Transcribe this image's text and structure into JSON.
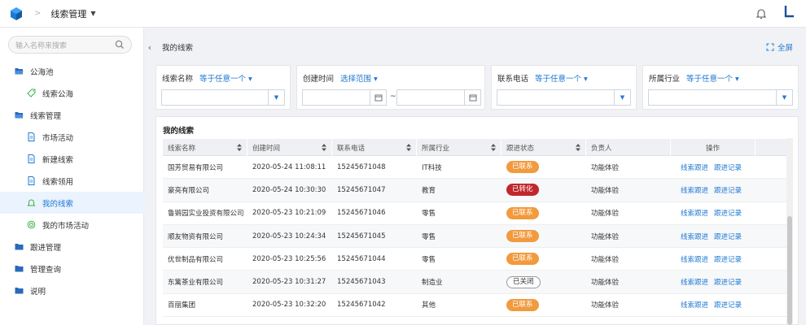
{
  "topbar": {
    "title": "线索管理"
  },
  "search": {
    "placeholder": "输入名称来搜索"
  },
  "menu": [
    {
      "label": "公海池",
      "level": 1,
      "icon": "folder-open-icon"
    },
    {
      "label": "线索公海",
      "level": 2,
      "icon": "tag-icon"
    },
    {
      "label": "线索管理",
      "level": 1,
      "icon": "folder-open-icon"
    },
    {
      "label": "市场活动",
      "level": 2,
      "icon": "document-icon"
    },
    {
      "label": "新建线索",
      "level": 2,
      "icon": "document-icon"
    },
    {
      "label": "线索领用",
      "level": 2,
      "icon": "document-icon"
    },
    {
      "label": "我的线索",
      "level": 2,
      "icon": "bell-icon",
      "active": true
    },
    {
      "label": "我的市场活动",
      "level": 2,
      "icon": "target-icon"
    },
    {
      "label": "跟进管理",
      "level": 1,
      "icon": "folder-icon"
    },
    {
      "label": "管理查询",
      "level": 1,
      "icon": "folder-icon"
    },
    {
      "label": "说明",
      "level": 1,
      "icon": "folder-icon"
    }
  ],
  "main": {
    "header": "我的线索",
    "fullscreen": "全屏"
  },
  "filters": {
    "name": {
      "label": "线索名称",
      "cond": "等于任意一个"
    },
    "time": {
      "label": "创建时间",
      "cond": "选择范围",
      "sep": "~"
    },
    "phone": {
      "label": "联系电话",
      "cond": "等于任意一个"
    },
    "industry": {
      "label": "所属行业",
      "cond": "等于任意一个"
    }
  },
  "table": {
    "title": "我的线索",
    "columns": [
      "线索名称",
      "创建时间",
      "联系电话",
      "所属行业",
      "跟进状态",
      "负责人",
      "操作"
    ],
    "action1": "线索跟进",
    "action2": "跟进记录",
    "rows": [
      {
        "name": "国芳贸易有限公司",
        "time": "2020-05-24 11:08:11",
        "phone": "15245671048",
        "industry": "IT科技",
        "status": "已联系",
        "status_type": "orange",
        "owner": "功能体验"
      },
      {
        "name": "豪亮有限公司",
        "time": "2020-05-24 10:30:30",
        "phone": "15245671047",
        "industry": "教育",
        "status": "已转化",
        "status_type": "red",
        "owner": "功能体验"
      },
      {
        "name": "鲁锵园实业投资有限公司",
        "time": "2020-05-23 10:21:09",
        "phone": "15245671046",
        "industry": "零售",
        "status": "已联系",
        "status_type": "orange",
        "owner": "功能体验"
      },
      {
        "name": "顺友物资有限公司",
        "time": "2020-05-23 10:24:34",
        "phone": "15245671045",
        "industry": "零售",
        "status": "已联系",
        "status_type": "orange",
        "owner": "功能体验"
      },
      {
        "name": "优世制品有限公司",
        "time": "2020-05-23 10:25:56",
        "phone": "15245671044",
        "industry": "零售",
        "status": "已联系",
        "status_type": "orange",
        "owner": "功能体验"
      },
      {
        "name": "东篱茶业有限公司",
        "time": "2020-05-23 10:31:27",
        "phone": "15245671043",
        "industry": "制造业",
        "status": "已关闭",
        "status_type": "plain",
        "owner": "功能体验"
      },
      {
        "name": "百丽集团",
        "time": "2020-05-23 10:32:20",
        "phone": "15245671042",
        "industry": "其他",
        "status": "已联系",
        "status_type": "orange",
        "owner": "功能体验"
      }
    ]
  },
  "colors": {
    "accent": "#1f78d1",
    "status_orange": "#f19a3e",
    "status_red": "#c0272d"
  }
}
